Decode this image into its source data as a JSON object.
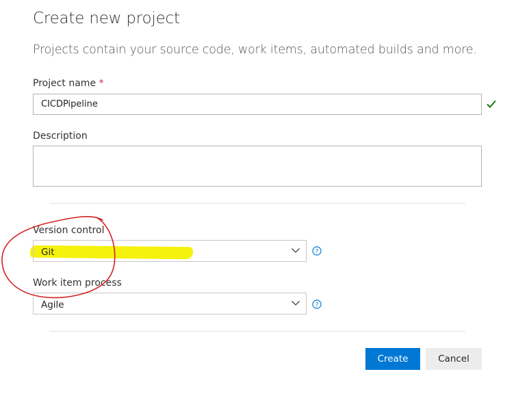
{
  "dialog": {
    "title": "Create new project",
    "subtitle": "Projects contain your source code, work items, automated builds and more."
  },
  "project_name": {
    "label": "Project name",
    "required_mark": "*",
    "value": "CICDPipeline",
    "valid_icon": "check-icon"
  },
  "description": {
    "label": "Description",
    "value": ""
  },
  "version_control": {
    "label": "Version control",
    "selected": "Git",
    "help_icon": "help-circle-icon"
  },
  "work_item_process": {
    "label": "Work item process",
    "selected": "Agile",
    "help_icon": "help-circle-icon"
  },
  "buttons": {
    "create": "Create",
    "cancel": "Cancel"
  },
  "annotations": {
    "highlight_color": "#f4f100",
    "circle_color": "#d42020"
  },
  "colors": {
    "primary": "#0078d4",
    "valid": "#107c10"
  }
}
